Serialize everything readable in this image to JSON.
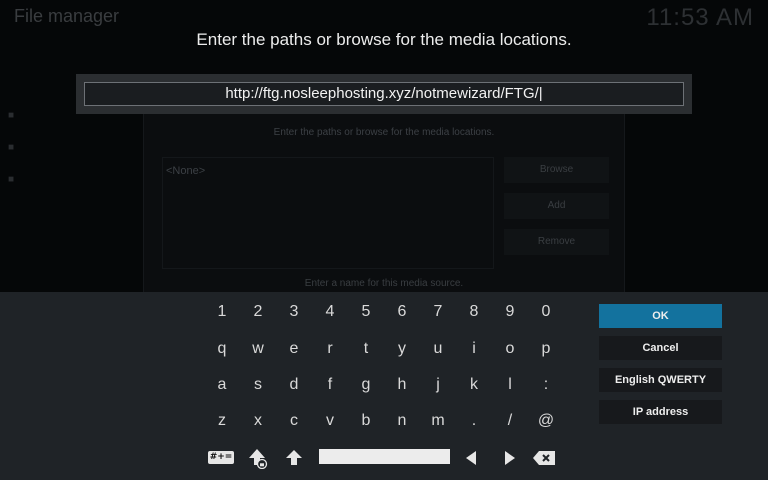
{
  "background": {
    "app_title": "File manager",
    "clock": "11:53 AM",
    "dialog_title": "Enter the paths or browse for the media locations.",
    "source_list_empty": "<None>",
    "buttons": [
      "Browse",
      "Add",
      "Remove"
    ],
    "hint": "Enter a name for this media source."
  },
  "keyboard_dialog": {
    "prompt": "Enter the paths or browse for the media locations.",
    "input_value": "http://ftg.nosleephosting.xyz/notmewizard/FTG/|",
    "rows": [
      [
        "1",
        "2",
        "3",
        "4",
        "5",
        "6",
        "7",
        "8",
        "9",
        "0"
      ],
      [
        "q",
        "w",
        "e",
        "r",
        "t",
        "y",
        "u",
        "i",
        "o",
        "p"
      ],
      [
        "a",
        "s",
        "d",
        "f",
        "g",
        "h",
        "j",
        "k",
        "l",
        ":"
      ],
      [
        "z",
        "x",
        "c",
        "v",
        "b",
        "n",
        "m",
        ".",
        "/",
        "@"
      ]
    ],
    "bottom_row": {
      "symbols_label": "#+=",
      "symbols_icon": "symbols-icon",
      "shift_lock_icon": "shift-lock-icon",
      "shift_icon": "shift-icon",
      "left_icon": "arrow-left-icon",
      "right_icon": "arrow-right-icon",
      "backspace_icon": "backspace-icon"
    },
    "side_buttons": {
      "ok": "OK",
      "cancel": "Cancel",
      "layout": "English QWERTY",
      "ip": "IP address"
    },
    "accent_color": "#13729e"
  }
}
